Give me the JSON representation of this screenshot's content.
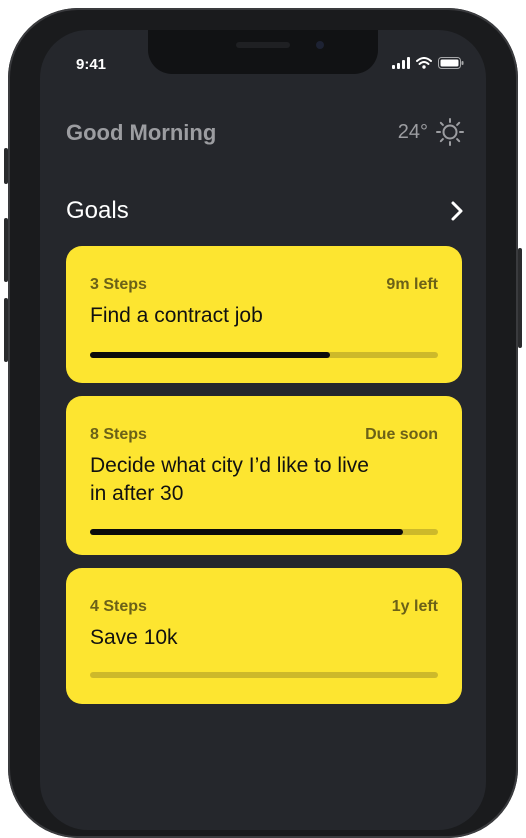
{
  "status_bar": {
    "time": "9:41"
  },
  "header": {
    "greeting": "Good Morning",
    "temperature": "24°",
    "weather_icon": "sun-icon"
  },
  "goals": {
    "title": "Goals",
    "items": [
      {
        "steps": "3 Steps",
        "due": "9m left",
        "title": "Find a contract job",
        "progress": 0.69
      },
      {
        "steps": "8 Steps",
        "due": "Due soon",
        "title": "Decide what city I’d like to live in after 30",
        "progress": 0.9
      },
      {
        "steps": "4 Steps",
        "due": "1y left",
        "title": "Save 10k",
        "progress": 0
      }
    ]
  },
  "colors": {
    "background": "#25272c",
    "card": "#fde530",
    "text_primary": "#ffffff",
    "text_muted": "#9c9da1",
    "progress_fill": "#0b0b0b",
    "progress_track": "#cdb92a"
  }
}
